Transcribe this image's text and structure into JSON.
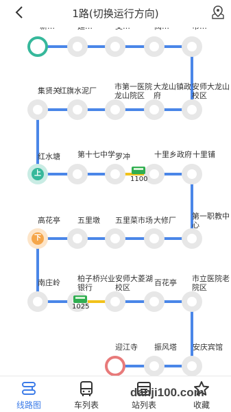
{
  "header": {
    "title": "1路(切换运行方向)",
    "back_icon": "chevron-left-icon",
    "map_icon": "map-pin-icon"
  },
  "stations": {
    "r1": [
      "新…",
      "延…",
      "支…",
      "阀…",
      "市…"
    ],
    "r2": [
      "集贤关",
      "红旗水泥厂",
      "市第一医院龙山院区",
      "大龙山镇政府",
      "安师大龙山校区"
    ],
    "r3": [
      "红水塘",
      "第十七中学",
      "罗冲",
      "十里乡政府",
      "十里铺"
    ],
    "r4": [
      "高花亭",
      "五里墩",
      "五里菜市场",
      "大修厂",
      "第一职教中心"
    ],
    "r5": [
      "南庄岭",
      "柏子桥兴业银行",
      "安师大菱湖校区",
      "百花亭",
      "市立医院老院区"
    ],
    "r6": [
      "迎江寺",
      "振风塔",
      "安庆宾馆"
    ]
  },
  "markers": {
    "up": "上",
    "down": "下"
  },
  "buses": [
    {
      "number": "1100"
    },
    {
      "number": "1025"
    }
  ],
  "tabs": [
    {
      "label": "线路图",
      "icon": "route-icon",
      "active": true
    },
    {
      "label": "车列表",
      "icon": "bus-icon",
      "active": false
    },
    {
      "label": "站列表",
      "icon": "station-list-icon",
      "active": false
    },
    {
      "label": "收藏",
      "icon": "star-icon",
      "active": false
    }
  ],
  "watermark": "danji100.com",
  "colors": {
    "line": "#4a86e8",
    "active_segment": "#f2c21b",
    "start": "#36b89b",
    "end": "#e87a7a",
    "accent": "#3b7be8"
  }
}
